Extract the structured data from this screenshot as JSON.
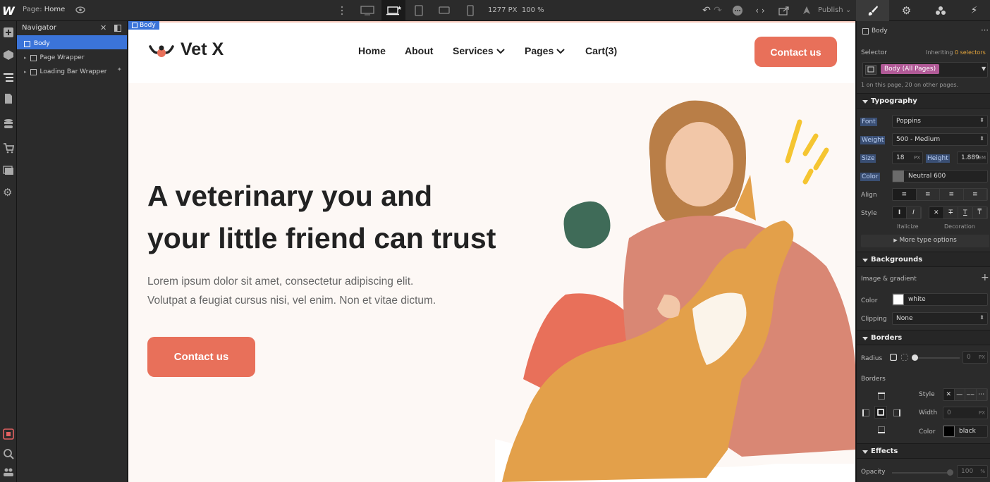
{
  "topbar": {
    "logo": "W",
    "page_label": "Page:",
    "page_name": "Home",
    "canvas_width": "1277 PX",
    "zoom": "100 %",
    "publish_label": "Publish"
  },
  "left_icons": [
    "add-icon",
    "components-icon",
    "navigator-icon",
    "pages-icon",
    "cms-icon",
    "ecommerce-icon",
    "assets-icon",
    "settings-icon",
    "record-icon",
    "search-icon",
    "users-icon"
  ],
  "navigator": {
    "title": "Navigator",
    "items": [
      {
        "label": "Body"
      },
      {
        "label": "Page Wrapper"
      },
      {
        "label": "Loading Bar Wrapper"
      }
    ]
  },
  "canvas": {
    "body_tag": "Body",
    "brand": "Vet X",
    "menu": [
      {
        "label": "Home"
      },
      {
        "label": "About"
      },
      {
        "label": "Services"
      },
      {
        "label": "Pages"
      },
      {
        "label": "Cart(3)"
      }
    ],
    "nav_cta": "Contact us",
    "hero_title_line1": "A veterinary you and",
    "hero_title_line2": "your little friend can trust",
    "hero_text_line1": "Lorem ipsum dolor sit amet, consectetur adipiscing elit.",
    "hero_text_line2": "Volutpat a feugiat cursus nisi, vel enim. Non et vitae dictum.",
    "hero_cta": "Contact us",
    "accent_color": "#e8705a",
    "blob_color": "#3f6b58",
    "yellow_color": "#f5c531"
  },
  "panel": {
    "element": "Body",
    "selector_label": "Selector",
    "inheriting_label": "Inheriting",
    "inheriting_count": "0 selectors",
    "selector_value": "Body (All Pages)",
    "page_count_note": "1 on this page, 20 on other pages.",
    "typography": {
      "title": "Typography",
      "font_label": "Font",
      "font_value": "Poppins",
      "weight_label": "Weight",
      "weight_value": "500 - Medium",
      "size_label": "Size",
      "size_value": "18",
      "size_unit": "PX",
      "height_label": "Height",
      "height_value": "1.889",
      "height_unit": "EM",
      "color_label": "Color",
      "color_value": "Neutral 600",
      "align_label": "Align",
      "style_label": "Style",
      "italicize_label": "Italicize",
      "decoration_label": "Decoration",
      "more_label": "More type options"
    },
    "backgrounds": {
      "title": "Backgrounds",
      "image_label": "Image & gradient",
      "color_label": "Color",
      "color_value": "white",
      "clipping_label": "Clipping",
      "clipping_value": "None"
    },
    "borders": {
      "title": "Borders",
      "radius_label": "Radius",
      "radius_value": "0",
      "radius_unit": "PX",
      "borders_label": "Borders",
      "style_label": "Style",
      "width_label": "Width",
      "width_value": "0",
      "width_unit": "PX",
      "color_label": "Color",
      "color_value": "black"
    },
    "effects": {
      "title": "Effects",
      "opacity_label": "Opacity",
      "opacity_value": "100",
      "opacity_unit": "%"
    }
  }
}
